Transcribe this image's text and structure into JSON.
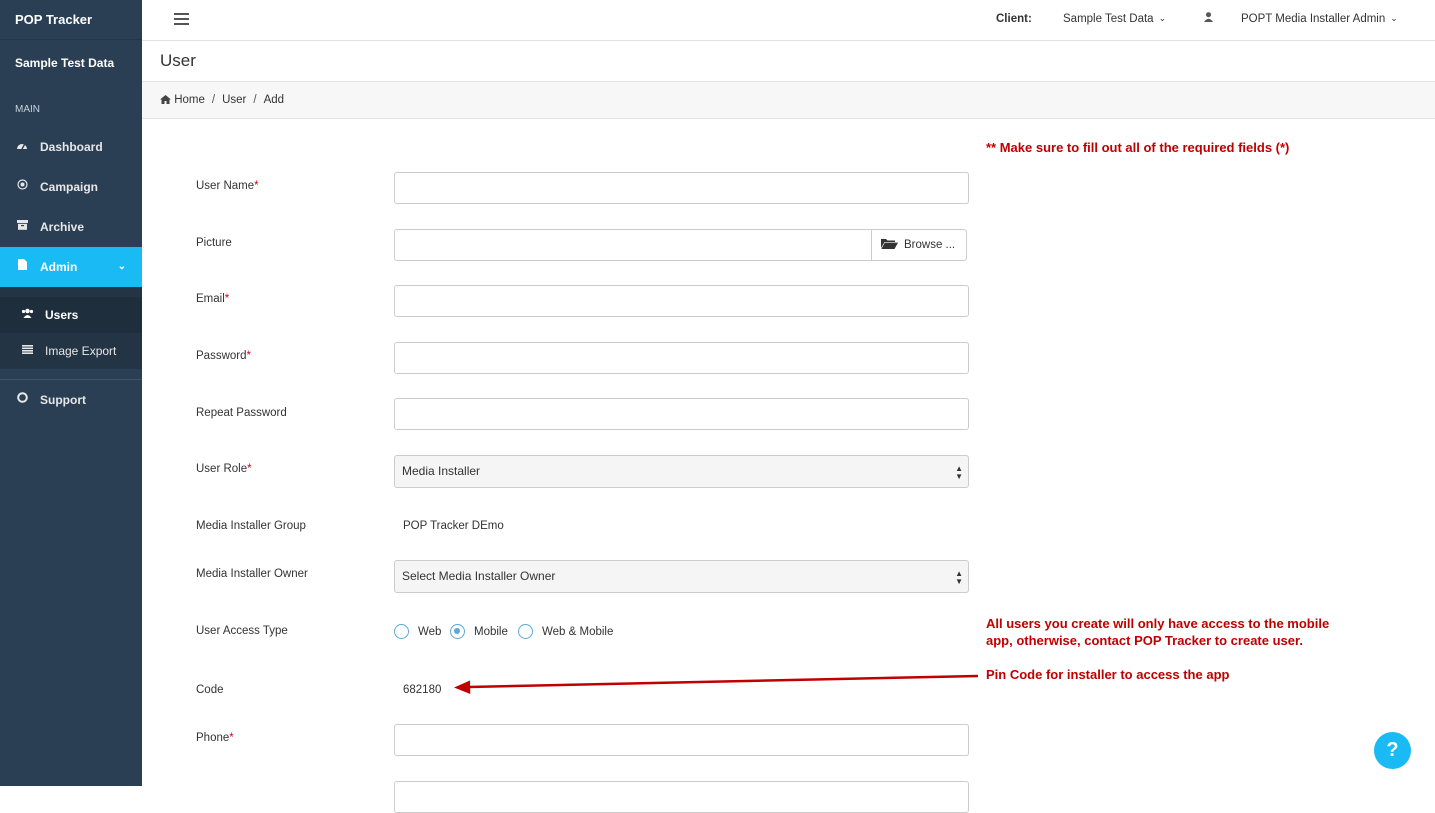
{
  "sidebar": {
    "brand": "POP Tracker",
    "client": "Sample Test Data",
    "section": "MAIN",
    "items": [
      {
        "label": "Dashboard",
        "icon": "dashboard-icon"
      },
      {
        "label": "Campaign",
        "icon": "target-icon"
      },
      {
        "label": "Archive",
        "icon": "archive-icon"
      },
      {
        "label": "Admin",
        "icon": "file-icon"
      }
    ],
    "subitems": [
      {
        "label": "Users",
        "icon": "users-icon"
      },
      {
        "label": "Image Export",
        "icon": "list-icon"
      }
    ],
    "support": {
      "label": "Support",
      "icon": "lifebuoy-icon"
    }
  },
  "topbar": {
    "client_label": "Client:",
    "client_value": "Sample Test Data",
    "user_name": "POPT Media Installer Admin"
  },
  "page": {
    "title": "User",
    "breadcrumb": [
      "Home",
      "User",
      "Add"
    ]
  },
  "form": {
    "user_name_label": "User Name",
    "picture_label": "Picture",
    "browse_label": "Browse ...",
    "email_label": "Email",
    "password_label": "Password",
    "repeat_password_label": "Repeat Password",
    "user_role_label": "User Role",
    "user_role_value": "Media Installer",
    "group_label": "Media Installer Group",
    "group_value": "POP Tracker DEmo",
    "owner_label": "Media Installer Owner",
    "owner_value": "Select Media Installer Owner",
    "access_type_label": "User Access Type",
    "access_options": [
      "Web",
      "Mobile",
      "Web & Mobile"
    ],
    "access_selected": "Mobile",
    "code_label": "Code",
    "code_value": "682180",
    "phone_label": "Phone",
    "required_mark": "*"
  },
  "annotations": {
    "required_note": "** Make sure to fill out all of the required fields (*)",
    "access_note_line1": "All users you create will only have access to the mobile",
    "access_note_line2": "app, otherwise, contact POP Tracker to create user.",
    "pin_note": "Pin Code for installer to access the app",
    "color": "#c00000"
  },
  "help": {
    "label": "?",
    "color": "#1abbf4"
  }
}
